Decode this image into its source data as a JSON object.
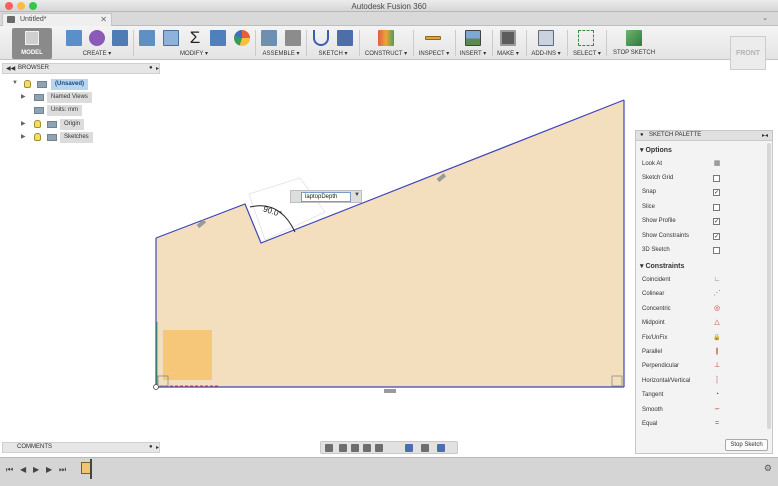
{
  "window": {
    "title": "Autodesk Fusion 360"
  },
  "tab": {
    "label": "Untitled*",
    "close": "✕"
  },
  "toolbar": {
    "workspace": "MODEL",
    "groups": [
      {
        "label": "CREATE ▾"
      },
      {
        "label": "MODIFY ▾"
      },
      {
        "label": "ASSEMBLE ▾"
      },
      {
        "label": "SKETCH ▾"
      },
      {
        "label": "CONSTRUCT ▾"
      },
      {
        "label": "INSPECT ▾"
      },
      {
        "label": "INSERT ▾"
      },
      {
        "label": "MAKE ▾"
      },
      {
        "label": "ADD-INS ▾"
      },
      {
        "label": "SELECT ▾"
      },
      {
        "label": "STOP SKETCH"
      }
    ]
  },
  "viewcube": {
    "label": "FRONT"
  },
  "browser": {
    "title": "BROWSER",
    "root": "(Unsaved)",
    "items": [
      {
        "label": "Named Views"
      },
      {
        "label": "Units: mm"
      },
      {
        "label": "Origin"
      },
      {
        "label": "Sketches"
      }
    ]
  },
  "comments": {
    "title": "COMMENTS"
  },
  "sketch": {
    "dimension_value": "laptopDepth",
    "angle_label": "90.0°",
    "fill_color": "#f3dfbd",
    "line_color": "#3f45b8"
  },
  "palette": {
    "title": "SKETCH PALETTE",
    "options_title": "Options",
    "options": [
      {
        "label": "Look At",
        "state": "icon"
      },
      {
        "label": "Sketch Grid",
        "state": ""
      },
      {
        "label": "Snap",
        "state": "✓"
      },
      {
        "label": "Slice",
        "state": ""
      },
      {
        "label": "Show Profile",
        "state": "✓"
      },
      {
        "label": "Show Constraints",
        "state": "✓"
      },
      {
        "label": "3D Sketch",
        "state": ""
      }
    ],
    "constraints_title": "Constraints",
    "constraints": [
      {
        "label": "Coincident",
        "icon": "∟"
      },
      {
        "label": "Colinear",
        "icon": "⋰"
      },
      {
        "label": "Concentric",
        "icon": "◎"
      },
      {
        "label": "Midpoint",
        "icon": "△"
      },
      {
        "label": "Fix/UnFix",
        "icon": "🔒"
      },
      {
        "label": "Parallel",
        "icon": "∥"
      },
      {
        "label": "Perpendicular",
        "icon": "⊥"
      },
      {
        "label": "Horizontal/Vertical",
        "icon": "┆"
      },
      {
        "label": "Tangent",
        "icon": "◔"
      },
      {
        "label": "Smooth",
        "icon": "∽"
      },
      {
        "label": "Equal",
        "icon": "="
      }
    ],
    "stop_label": "Stop Sketch"
  },
  "timeline": {
    "buttons": [
      "⏮",
      "◀",
      "▶",
      "▶",
      "⏭"
    ]
  }
}
